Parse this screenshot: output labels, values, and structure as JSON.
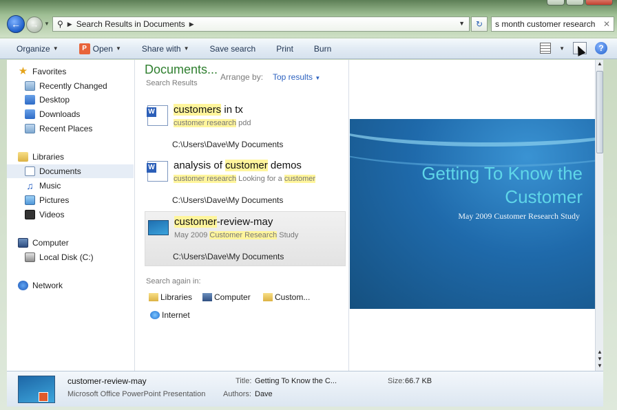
{
  "window": {
    "address": {
      "crumb": "Search Results in Documents"
    },
    "search": {
      "value": "s month customer research"
    }
  },
  "toolbar": {
    "organize": "Organize",
    "open": "Open",
    "share_with": "Share with",
    "save_search": "Save search",
    "print": "Print",
    "burn": "Burn"
  },
  "nav": {
    "favorites": "Favorites",
    "recently_changed": "Recently Changed",
    "desktop": "Desktop",
    "downloads": "Downloads",
    "recent_places": "Recent Places",
    "libraries": "Libraries",
    "documents": "Documents",
    "music": "Music",
    "pictures": "Pictures",
    "videos": "Videos",
    "computer": "Computer",
    "local_disk": "Local Disk (C:)",
    "network": "Network"
  },
  "results": {
    "title": "Documents...",
    "subtitle": "Search Results",
    "arrange_label": "Arrange by:",
    "arrange_value": "Top results",
    "items": [
      {
        "name_hl": "customers",
        "name_rest": " in tx",
        "snip_hl": "customer research",
        "snip_rest": " pdd",
        "snip_rest2": "",
        "snip_hl2": "",
        "path": "C:\\Users\\Dave\\My Documents"
      },
      {
        "name_pre": "analysis of ",
        "name_hl": "customer",
        "name_rest": " demos",
        "snip_hl": "customer research",
        "snip_rest": " Looking for a ",
        "snip_hl2": "customer",
        "path": "C:\\Users\\Dave\\My Documents"
      },
      {
        "name_hl": "customer",
        "name_rest": "-review-may",
        "snip_pre": "May 2009 ",
        "snip_hl": "Customer Research",
        "snip_rest": " Study",
        "path": "C:\\Users\\Dave\\My Documents"
      }
    ],
    "search_again_label": "Search again in:",
    "search_again": {
      "libraries": "Libraries",
      "computer": "Computer",
      "custom": "Custom...",
      "internet": "Internet"
    }
  },
  "preview": {
    "title_line1": "Getting To Know the",
    "title_line2": "Customer",
    "subtitle": "May 2009 Customer Research Study"
  },
  "details": {
    "name": "customer-review-may",
    "type": "Microsoft Office PowerPoint Presentation",
    "title_label": "Title:",
    "title_value": "Getting To Know the C...",
    "authors_label": "Authors:",
    "authors_value": "Dave",
    "size_label": "Size:",
    "size_value": "66.7 KB"
  },
  "colors": {
    "library_title": "#2f7f2f",
    "highlight": "#fff59c",
    "link": "#2d62c0",
    "slide_title": "#5fd6e8"
  }
}
